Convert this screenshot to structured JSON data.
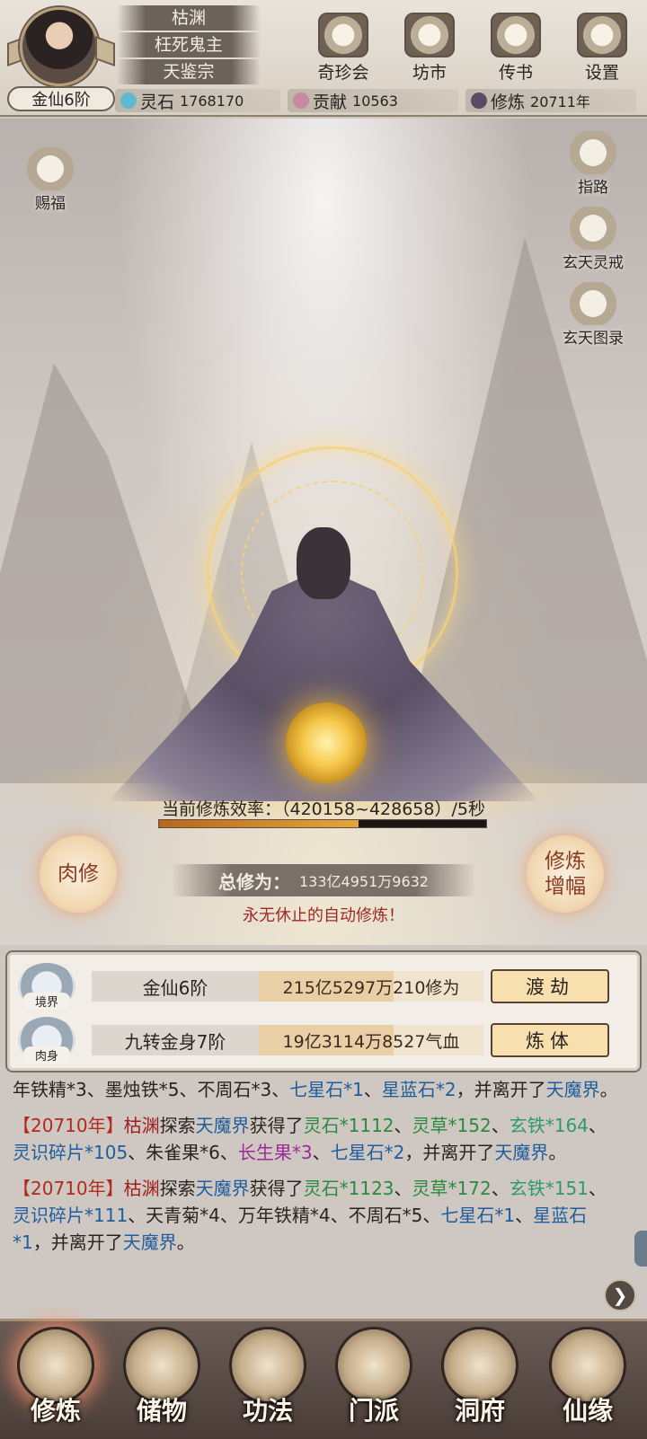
{
  "header": {
    "rank": "金仙6阶",
    "name_plates": [
      "枯渊",
      "枉死鬼主",
      "天鉴宗"
    ],
    "buttons": [
      {
        "label": "奇珍会",
        "icon": "treasure-pavilion-icon"
      },
      {
        "label": "坊市",
        "icon": "market-icon"
      },
      {
        "label": "传书",
        "icon": "scroll-letter-icon"
      },
      {
        "label": "设置",
        "icon": "gear-icon"
      }
    ],
    "resources": [
      {
        "label": "灵石",
        "value": "1768170",
        "color": "#5fb9d0"
      },
      {
        "label": "贡献",
        "value": "10563",
        "color": "#c98aa0"
      },
      {
        "label": "修炼",
        "value": "20711年",
        "color": "#5a4a66"
      }
    ]
  },
  "scene": {
    "bless_label": "赐福",
    "side_buttons": [
      {
        "label": "指路",
        "icon": "mountain-icon"
      },
      {
        "label": "玄天灵戒",
        "icon": "ring-icon"
      },
      {
        "label": "玄天图录",
        "icon": "scroll-icon"
      }
    ],
    "rate_text": "当前修炼效率：（420158~428658）/5秒",
    "rate_progress": 0.61,
    "total_label": "总修为：",
    "total_value": "133亿4951万9632",
    "auto_note": "永无休止的自动修炼！",
    "left_round": "肉修",
    "right_round_1": "修炼",
    "right_round_2": "增幅"
  },
  "status": [
    {
      "badge": "境界",
      "name": "金仙6阶",
      "value": "215亿5297万210修为",
      "action": "渡劫",
      "fill": 0.6
    },
    {
      "badge": "肉身",
      "name": "九转金身7阶",
      "value": "19亿3114万8527气血",
      "action": "炼体",
      "fill": 0.6
    }
  ],
  "log": [
    {
      "segments": [
        {
          "t": "年铁精*3、墨烛铁*5、不周石*3、",
          "c": ""
        },
        {
          "t": "七星石*1",
          "c": "c-blue"
        },
        {
          "t": "、",
          "c": ""
        },
        {
          "t": "星蓝石*2",
          "c": "c-blue"
        },
        {
          "t": "，并离开了",
          "c": ""
        },
        {
          "t": "天魔界",
          "c": "c-blue"
        },
        {
          "t": "。",
          "c": ""
        }
      ]
    },
    {
      "segments": [
        {
          "t": "【20710年】",
          "c": "c-red"
        },
        {
          "t": "枯渊",
          "c": "c-name"
        },
        {
          "t": "探索",
          "c": ""
        },
        {
          "t": "天魔界",
          "c": "c-blue"
        },
        {
          "t": "获得了",
          "c": ""
        },
        {
          "t": "灵石*1112",
          "c": "c-green"
        },
        {
          "t": "、",
          "c": ""
        },
        {
          "t": "灵草*152",
          "c": "c-green"
        },
        {
          "t": "、",
          "c": ""
        },
        {
          "t": "玄铁*164",
          "c": "c-ltg"
        },
        {
          "t": "、",
          "c": ""
        },
        {
          "t": "灵识碎片*105",
          "c": "c-blue"
        },
        {
          "t": "、朱雀果*6、",
          "c": ""
        },
        {
          "t": "长生果*3",
          "c": "c-purple"
        },
        {
          "t": "、",
          "c": ""
        },
        {
          "t": "七星石*2",
          "c": "c-blue"
        },
        {
          "t": "，并离开了",
          "c": ""
        },
        {
          "t": "天魔界",
          "c": "c-blue"
        },
        {
          "t": "。",
          "c": ""
        }
      ]
    },
    {
      "segments": [
        {
          "t": "【20710年】",
          "c": "c-red"
        },
        {
          "t": "枯渊",
          "c": "c-name"
        },
        {
          "t": "探索",
          "c": ""
        },
        {
          "t": "天魔界",
          "c": "c-blue"
        },
        {
          "t": "获得了",
          "c": ""
        },
        {
          "t": "灵石*1123",
          "c": "c-green"
        },
        {
          "t": "、",
          "c": ""
        },
        {
          "t": "灵草*172",
          "c": "c-green"
        },
        {
          "t": "、",
          "c": ""
        },
        {
          "t": "玄铁*151",
          "c": "c-ltg"
        },
        {
          "t": "、",
          "c": ""
        },
        {
          "t": "灵识碎片*111",
          "c": "c-blue"
        },
        {
          "t": "、天青菊*4、万年铁精*4、不周石*5、",
          "c": ""
        },
        {
          "t": "七星石*1",
          "c": "c-blue"
        },
        {
          "t": "、",
          "c": ""
        },
        {
          "t": "星蓝石*1",
          "c": "c-blue"
        },
        {
          "t": "，并离开了",
          "c": ""
        },
        {
          "t": "天魔界",
          "c": "c-blue"
        },
        {
          "t": "。",
          "c": ""
        }
      ]
    }
  ],
  "nav": [
    {
      "label": "修炼",
      "icon": "meditation-icon",
      "active": true
    },
    {
      "label": "储物",
      "icon": "bag-icon",
      "active": false
    },
    {
      "label": "功法",
      "icon": "manual-icon",
      "active": false
    },
    {
      "label": "门派",
      "icon": "sect-gate-icon",
      "active": false
    },
    {
      "label": "洞府",
      "icon": "cave-icon",
      "active": false
    },
    {
      "label": "仙缘",
      "icon": "fortune-icon",
      "active": false
    }
  ]
}
